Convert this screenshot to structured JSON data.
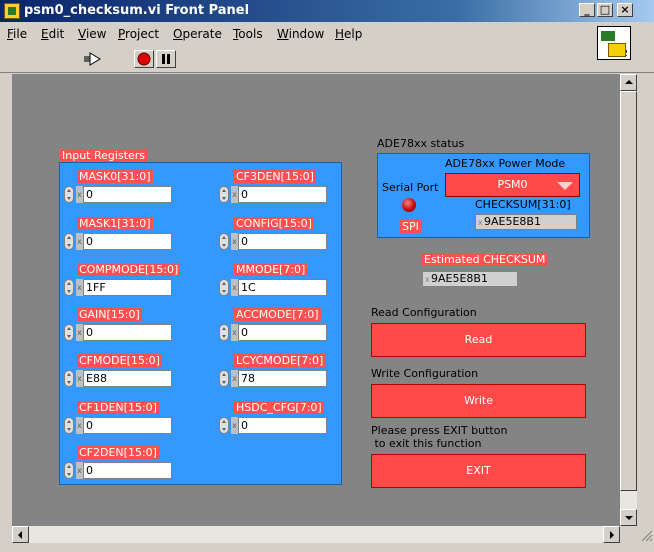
{
  "window": {
    "title": "psm0_checksum.vi Front Panel",
    "min": "_",
    "max": "□",
    "close": "×"
  },
  "menu": [
    {
      "letter": "F",
      "rest": "ile"
    },
    {
      "letter": "E",
      "rest": "dit"
    },
    {
      "letter": "V",
      "rest": "iew"
    },
    {
      "letter": "P",
      "rest": "roject"
    },
    {
      "letter": "O",
      "rest": "perate"
    },
    {
      "letter": "T",
      "rest": "ools"
    },
    {
      "letter": "W",
      "rest": "indow"
    },
    {
      "letter": "H",
      "rest": "elp"
    }
  ],
  "vi_icon_number": "2",
  "input_registers": {
    "title": "Input Registers",
    "left": [
      {
        "label": "MASK0[31:0]",
        "value": "0"
      },
      {
        "label": "MASK1[31:0]",
        "value": "0"
      },
      {
        "label": "COMPMODE[15:0]",
        "value": "1FF"
      },
      {
        "label": "GAIN[15:0]",
        "value": "0"
      },
      {
        "label": "CFMODE[15:0]",
        "value": "E88"
      },
      {
        "label": "CF1DEN[15:0]",
        "value": "0"
      },
      {
        "label": "CF2DEN[15:0]",
        "value": "0"
      }
    ],
    "right": [
      {
        "label": "CF3DEN[15:0]",
        "value": "0"
      },
      {
        "label": "CONFIG[15:0]",
        "value": "0"
      },
      {
        "label": "MMODE[7:0]",
        "value": "1C"
      },
      {
        "label": "ACCMODE[7:0]",
        "value": "0"
      },
      {
        "label": "LCYCMODE[7:0]",
        "value": "78"
      },
      {
        "label": "HSDC_CFG[7:0]",
        "value": "0"
      }
    ]
  },
  "status": {
    "title": "ADE78xx status",
    "power_mode_label": "ADE78xx Power Mode",
    "power_mode_value": "PSM0",
    "serial_port_label": "Serial Port",
    "serial_port_value": "SPI",
    "checksum_label": "CHECKSUM[31:0]",
    "checksum_value": "9AE5E8B1"
  },
  "estimated": {
    "label": "Estimated CHECKSUM",
    "value": "9AE5E8B1"
  },
  "read": {
    "section_label": "Read Configuration",
    "button": "Read"
  },
  "write": {
    "section_label": "Write Configuration",
    "button": "Write"
  },
  "exit": {
    "prompt_line1": "Please press EXIT button",
    "prompt_line2": " to exit this function",
    "button": "EXIT"
  },
  "colors": {
    "accent_red": "#ff4a4a",
    "panel_blue": "#3399ff",
    "panel_gray": "#848484"
  }
}
